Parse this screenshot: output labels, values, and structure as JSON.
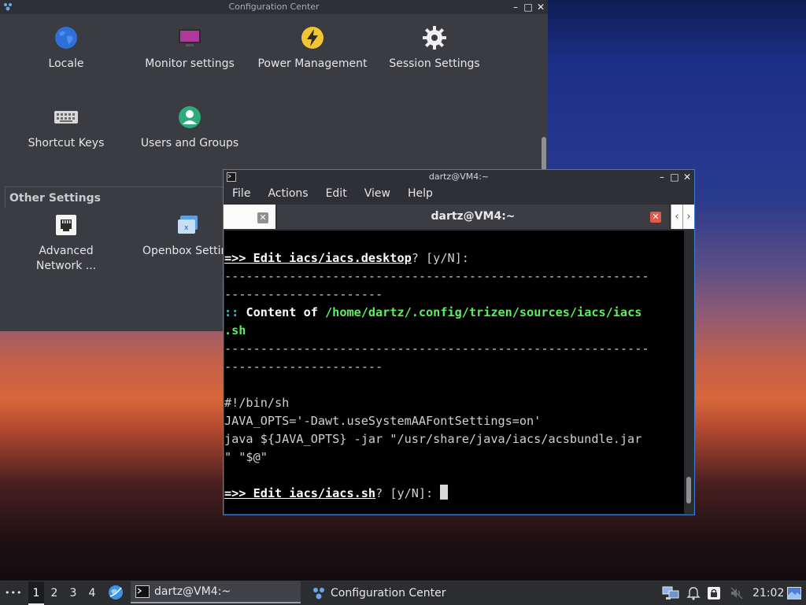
{
  "config_center": {
    "title": "Configuration Center",
    "items": [
      {
        "label": "Locale",
        "icon": "globe-icon"
      },
      {
        "label": "Monitor settings",
        "icon": "monitor-icon"
      },
      {
        "label": "Power Management",
        "icon": "lightning-icon"
      },
      {
        "label": "Session Settings",
        "icon": "gear-icon"
      },
      {
        "label": "Shortcut Keys",
        "icon": "keyboard-icon"
      },
      {
        "label": "Users and Groups",
        "icon": "user-icon"
      }
    ],
    "other_settings": {
      "label": "Other Settings",
      "items": [
        {
          "label_line1": "Advanced",
          "label_line2": "Network ...",
          "icon": "network-icon"
        },
        {
          "label": "Openbox Settin",
          "icon": "openbox-icon"
        }
      ]
    }
  },
  "terminal": {
    "title": "dartz@VM4:~",
    "menu": [
      "File",
      "Actions",
      "Edit",
      "View",
      "Help"
    ],
    "tab_active_label": "dartz@VM4:~",
    "lines": {
      "l1_prefix": "=>> Edit iacs/",
      "l1_file": "iacs.desktop",
      "l1_suffix": "? [y/N]:",
      "dash1": "-----------------------------------------------------------",
      "dash1b": "----------------------",
      "l2_prefix": "::",
      "l2_label": " Content of ",
      "l2_path": "/home/dartz/.config/trizen/sources/iacs/iacs",
      "l2_path_cont": ".sh",
      "dash2": "-----------------------------------------------------------",
      "dash2b": "----------------------",
      "code1": "#!/bin/sh",
      "code2": "JAVA_OPTS='-Dawt.useSystemAAFontSettings=on'",
      "code3": "java ${JAVA_OPTS} -jar \"/usr/share/java/iacs/acsbundle.jar",
      "code3b": "\" \"$@\"",
      "l3_prefix": "=>> Edit iacs/",
      "l3_file": "iacs.sh",
      "l3_suffix": "? [y/N]: "
    }
  },
  "taskbar": {
    "menu_dots": "•••",
    "workspaces": [
      "1",
      "2",
      "3",
      "4"
    ],
    "active_workspace": "1",
    "tasks": [
      {
        "label": "dartz@VM4:~",
        "icon": "terminal-icon",
        "active": true
      },
      {
        "label": "Configuration Center",
        "icon": "config-icon",
        "active": false
      }
    ],
    "clock": "21:02"
  },
  "colors": {
    "accent": "#3b7fd0",
    "prompt_green": "#5bf05b",
    "close_red": "#e05a47"
  }
}
